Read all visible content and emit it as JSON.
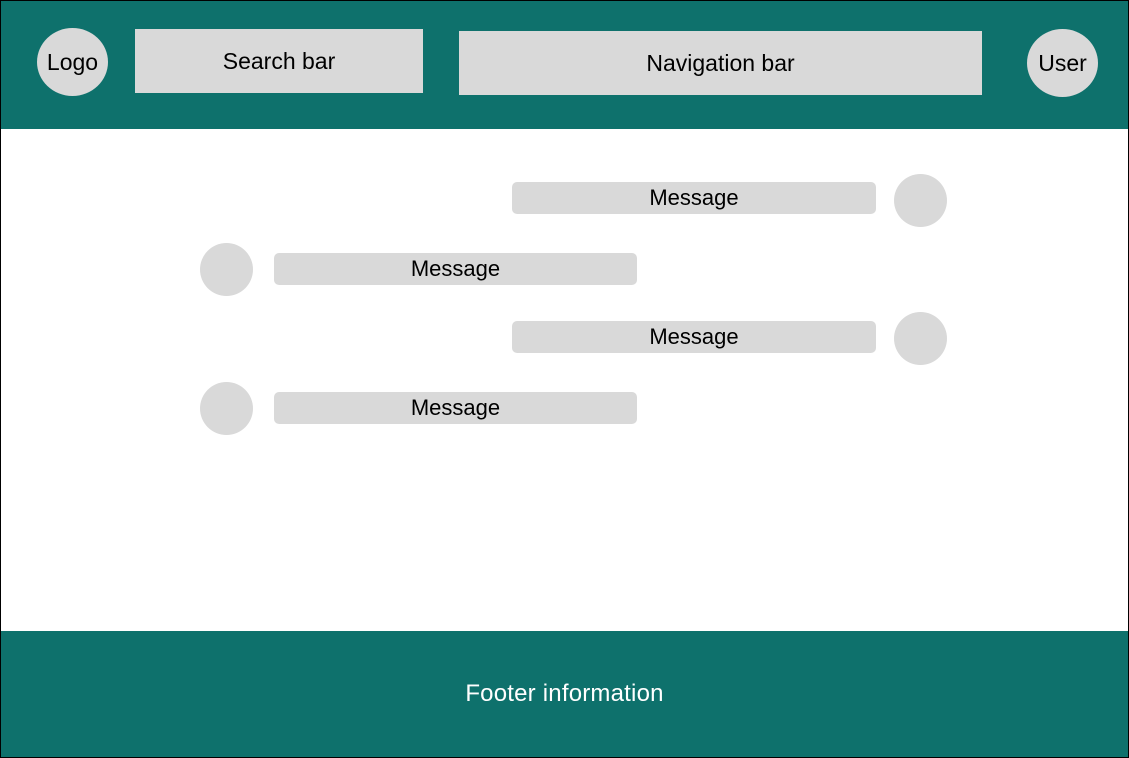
{
  "colors": {
    "header_bg": "#0e716c",
    "footer_bg": "#0e716c",
    "block_fill": "#d9d9d9",
    "page_bg": "#ffffff",
    "outline": "#000000"
  },
  "header": {
    "logo_label": "Logo",
    "search_label": "Search bar",
    "nav_label": "Navigation bar",
    "user_label": "User"
  },
  "messages": [
    {
      "label": "Message",
      "side": "right"
    },
    {
      "label": "Message",
      "side": "left"
    },
    {
      "label": "Message",
      "side": "right"
    },
    {
      "label": "Message",
      "side": "left"
    }
  ],
  "footer": {
    "text": "Footer information"
  }
}
